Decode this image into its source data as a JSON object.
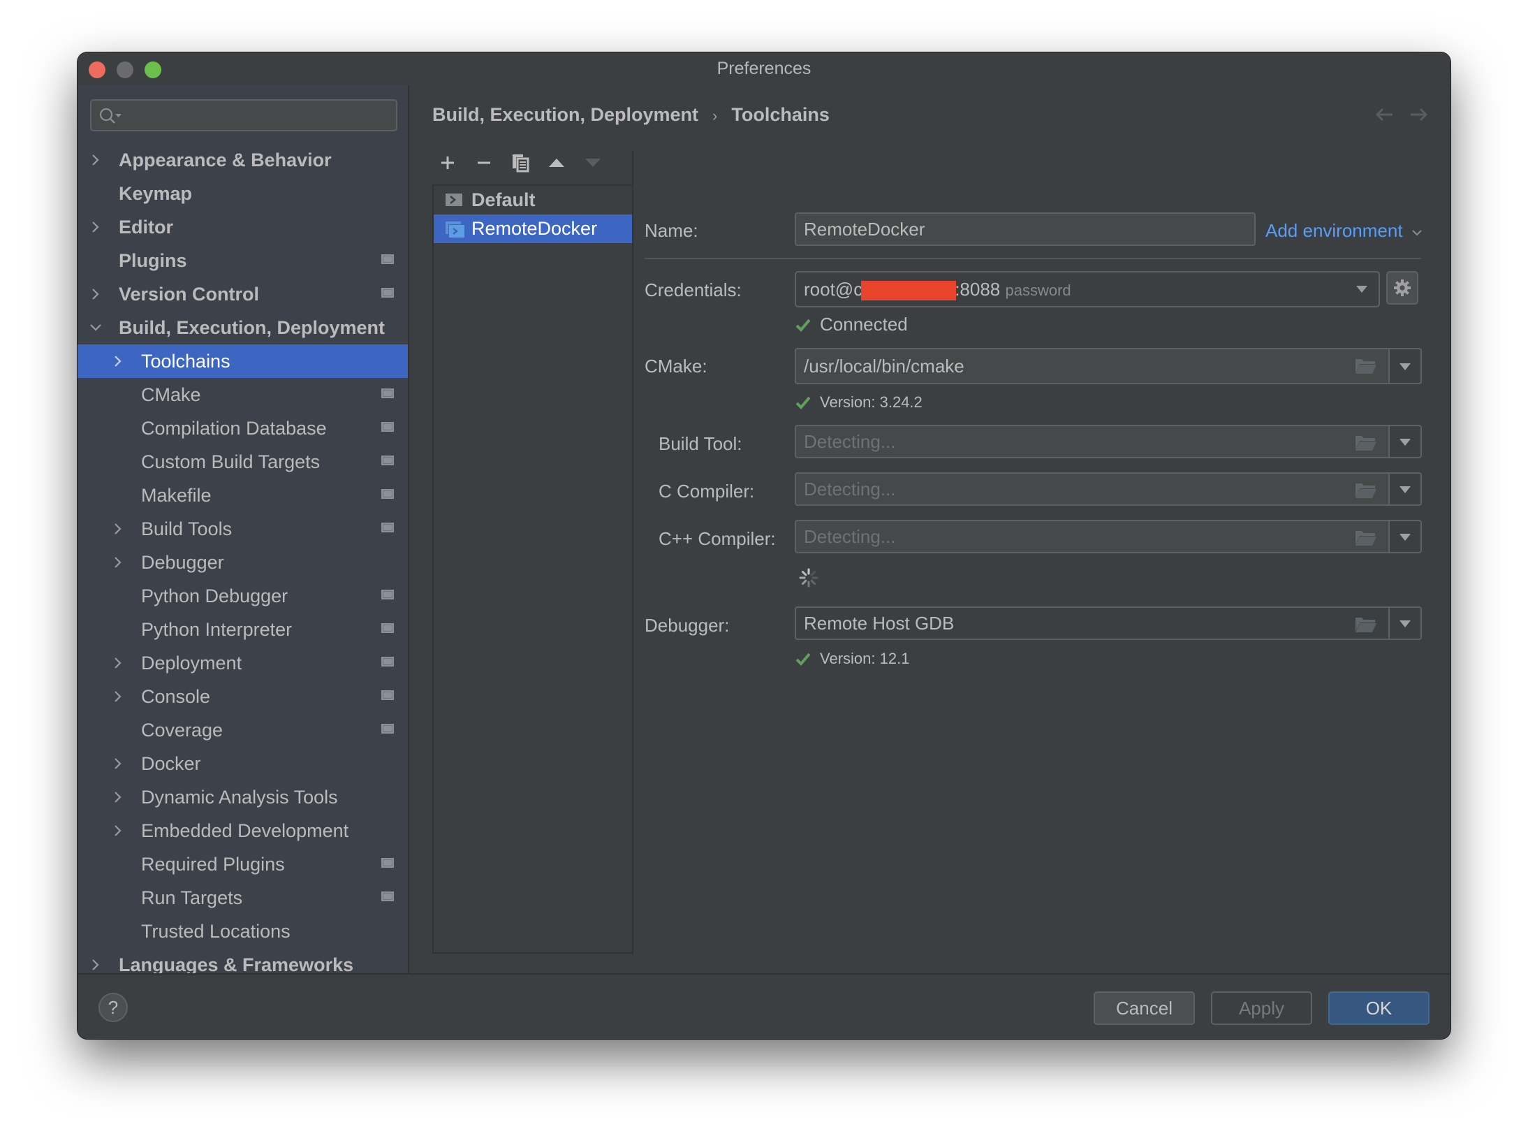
{
  "window": {
    "title": "Preferences"
  },
  "sidebar": {
    "search_placeholder": "",
    "items": [
      {
        "label": "Appearance & Behavior",
        "level": 0,
        "bold": true,
        "expandable": true,
        "expanded": false,
        "project_badge": false
      },
      {
        "label": "Keymap",
        "level": 0,
        "bold": true,
        "expandable": false,
        "project_badge": false
      },
      {
        "label": "Editor",
        "level": 0,
        "bold": true,
        "expandable": true,
        "expanded": false,
        "project_badge": false
      },
      {
        "label": "Plugins",
        "level": 0,
        "bold": true,
        "expandable": false,
        "project_badge": true
      },
      {
        "label": "Version Control",
        "level": 0,
        "bold": true,
        "expandable": true,
        "expanded": false,
        "project_badge": true
      },
      {
        "label": "Build, Execution, Deployment",
        "level": 0,
        "bold": true,
        "expandable": true,
        "expanded": true,
        "project_badge": false
      },
      {
        "label": "Toolchains",
        "level": 1,
        "bold": false,
        "expandable": true,
        "expanded": false,
        "selected": true,
        "project_badge": false
      },
      {
        "label": "CMake",
        "level": 1,
        "bold": false,
        "expandable": false,
        "project_badge": true
      },
      {
        "label": "Compilation Database",
        "level": 1,
        "bold": false,
        "expandable": false,
        "project_badge": true
      },
      {
        "label": "Custom Build Targets",
        "level": 1,
        "bold": false,
        "expandable": false,
        "project_badge": true
      },
      {
        "label": "Makefile",
        "level": 1,
        "bold": false,
        "expandable": false,
        "project_badge": true
      },
      {
        "label": "Build Tools",
        "level": 1,
        "bold": false,
        "expandable": true,
        "expanded": false,
        "project_badge": true
      },
      {
        "label": "Debugger",
        "level": 1,
        "bold": false,
        "expandable": true,
        "expanded": false,
        "project_badge": false
      },
      {
        "label": "Python Debugger",
        "level": 1,
        "bold": false,
        "expandable": false,
        "project_badge": true
      },
      {
        "label": "Python Interpreter",
        "level": 1,
        "bold": false,
        "expandable": false,
        "project_badge": true
      },
      {
        "label": "Deployment",
        "level": 1,
        "bold": false,
        "expandable": true,
        "expanded": false,
        "project_badge": true
      },
      {
        "label": "Console",
        "level": 1,
        "bold": false,
        "expandable": true,
        "expanded": false,
        "project_badge": true
      },
      {
        "label": "Coverage",
        "level": 1,
        "bold": false,
        "expandable": false,
        "project_badge": true
      },
      {
        "label": "Docker",
        "level": 1,
        "bold": false,
        "expandable": true,
        "expanded": false,
        "project_badge": false
      },
      {
        "label": "Dynamic Analysis Tools",
        "level": 1,
        "bold": false,
        "expandable": true,
        "expanded": false,
        "project_badge": false
      },
      {
        "label": "Embedded Development",
        "level": 1,
        "bold": false,
        "expandable": true,
        "expanded": false,
        "project_badge": false
      },
      {
        "label": "Required Plugins",
        "level": 1,
        "bold": false,
        "expandable": false,
        "project_badge": true
      },
      {
        "label": "Run Targets",
        "level": 1,
        "bold": false,
        "expandable": false,
        "project_badge": true
      },
      {
        "label": "Trusted Locations",
        "level": 1,
        "bold": false,
        "expandable": false,
        "project_badge": false
      },
      {
        "label": "Languages & Frameworks",
        "level": 0,
        "bold": true,
        "expandable": true,
        "expanded": false,
        "project_badge": false
      }
    ]
  },
  "breadcrumb": {
    "parent": "Build, Execution, Deployment",
    "separator": "›",
    "current": "Toolchains"
  },
  "toolchain_list": {
    "toolbar": [
      "add",
      "remove",
      "copy",
      "move-up",
      "move-down"
    ],
    "items": [
      {
        "label": "Default",
        "selected": false,
        "bold": true
      },
      {
        "label": "RemoteDocker",
        "selected": true,
        "bold": false
      }
    ]
  },
  "form": {
    "name_label": "Name:",
    "name_value": "RemoteDocker",
    "add_environment": "Add environment",
    "credentials_label": "Credentials:",
    "credentials_prefix": "root@c",
    "credentials_suffix": ":8088",
    "credentials_auth": "password",
    "credentials_status": "Connected",
    "cmake_label": "CMake:",
    "cmake_value": "/usr/local/bin/cmake",
    "cmake_status": "Version: 3.24.2",
    "build_tool_label": "Build Tool:",
    "build_tool_placeholder": "Detecting...",
    "c_compiler_label": "C Compiler:",
    "c_compiler_placeholder": "Detecting...",
    "cpp_compiler_label": "C++ Compiler:",
    "cpp_compiler_placeholder": "Detecting...",
    "debugger_label": "Debugger:",
    "debugger_value": "Remote Host GDB",
    "debugger_status": "Version: 12.1"
  },
  "footer": {
    "help": "?",
    "cancel": "Cancel",
    "apply": "Apply",
    "ok": "OK"
  },
  "colors": {
    "accent": "#3d66c3",
    "link": "#589df6",
    "success": "#5fa15c",
    "redaction": "#e8432b",
    "ok_button": "#365880"
  }
}
